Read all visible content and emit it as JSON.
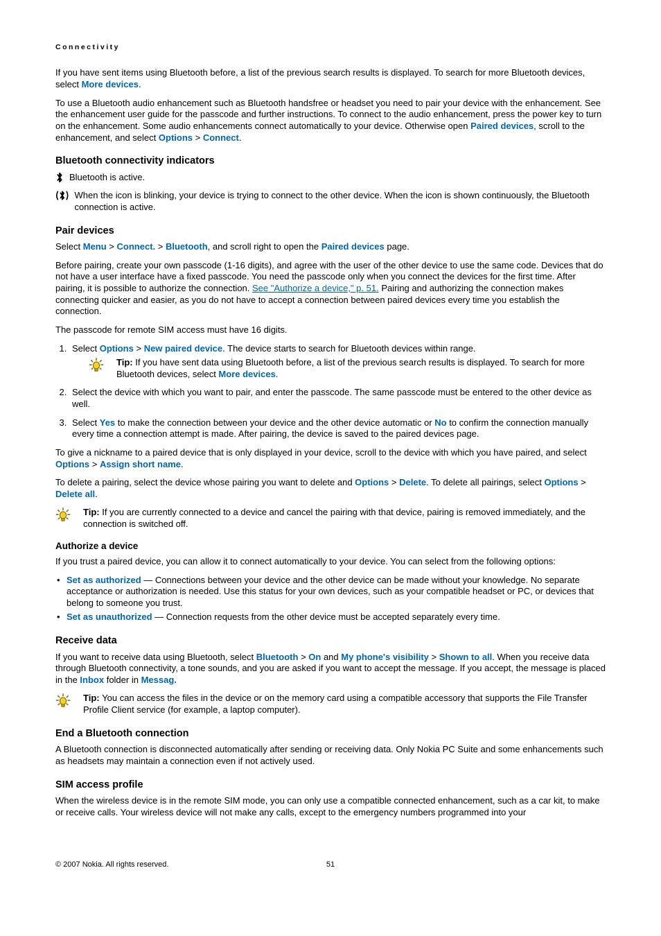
{
  "breadcrumb": "Connectivity",
  "intro": {
    "p1a": "If you have sent items using Bluetooth before, a list of the previous search results is displayed. To search for more Bluetooth devices, select ",
    "p1b": "More devices",
    "p1c": ".",
    "p2a": "To use a Bluetooth audio enhancement such as Bluetooth handsfree or headset you need to pair your device with the enhancement. See the enhancement user guide for the passcode and further instructions. To connect to the audio enhancement, press the power key to turn on the enhancement. Some audio enhancements connect automatically to your device. Otherwise open ",
    "p2b": "Paired devices",
    "p2c": ", scroll to the enhancement, and select ",
    "p2d": "Options",
    "gt": " > ",
    "p2e": "Connect",
    "p2f": "."
  },
  "bci": {
    "heading": "Bluetooth connectivity indicators",
    "l1": "  Bluetooth is active.",
    "l2": "  When the icon is blinking, your device is trying to connect to the other device. When the icon is shown continuously, the Bluetooth connection is active."
  },
  "pair": {
    "heading": "Pair devices",
    "sel_a": "Select ",
    "menu": "Menu",
    "connect": "Connect.",
    "bluetooth": "Bluetooth",
    "sel_b": ", and scroll right to open the ",
    "paired": "Paired devices",
    "sel_c": " page.",
    "p2a": "Before pairing, create your own passcode (1-16 digits), and agree with the user of the other device to use the same code. Devices that do not have a user interface have a fixed passcode. You need the passcode only when you connect the devices for the first time. After pairing, it is possible to authorize the connection. ",
    "p2link": "See \"Authorize a device,\" p. 51.",
    "p2b": " Pairing and authorizing the connection makes connecting quicker and easier, as you do not have to accept a connection between paired devices every time you establish the connection.",
    "p3": "The passcode for remote SIM access must have 16 digits.",
    "li1a": "Select ",
    "li1b": "Options",
    "li1c": "New paired device",
    "li1d": ". The device starts to search for Bluetooth devices within range.",
    "tip1_bold": "Tip: ",
    "tip1_a": "If you have sent data using Bluetooth before, a list of the previous search results is displayed. To search for more Bluetooth devices, select ",
    "tip1_b": "More devices",
    "tip1_c": ".",
    "li2": "Select the device with which you want to pair, and enter the passcode. The same passcode must be entered to the other device as well.",
    "li3a": "Select ",
    "li3yes": "Yes",
    "li3b": " to make the connection between your device and the other device automatic or ",
    "li3no": "No",
    "li3c": " to confirm the connection manually every time a connection attempt is made. After pairing, the device is saved to the paired devices page.",
    "nick_a": "To give a nickname to a paired device that is only displayed in your device, scroll to the device with which you have paired, and select ",
    "nick_opt": "Options",
    "nick_assign": "Assign short name",
    "nick_b": ".",
    "del_a": "To delete a pairing, select the device whose pairing you want to delete and ",
    "del_opt": "Options",
    "del_delete": "Delete",
    "del_b": ". To delete all pairings, select ",
    "del_opt2": "Options",
    "del_all": "Delete all",
    "del_c": ".",
    "tip2_bold": "Tip: ",
    "tip2": "If you are currently connected to a device and cancel the pairing with that device, pairing is removed immediately, and the connection is switched off."
  },
  "auth": {
    "heading": "Authorize a device",
    "p1": "If you trust a paired device, you can allow it to connect automatically to your device. You can select from the following options:",
    "b1_label": "Set as authorized",
    "b1_text": " — Connections between your device and the other device can be made without your knowledge. No separate acceptance or authorization is needed. Use this status for your own devices, such as your compatible headset or PC, or devices that belong to someone you trust.",
    "b2_label": "Set as unauthorized",
    "b2_text": " — Connection requests from the other device must be accepted separately every time."
  },
  "recv": {
    "heading": "Receive data",
    "p1a": "If you want to receive data using Bluetooth, select ",
    "bt": "Bluetooth",
    "on": "On",
    "p1b": " and ",
    "vis": "My phone's visibility",
    "shown": "Shown to all",
    "p1c": ". When you receive data through Bluetooth connectivity, a tone sounds, and you are asked if you want to accept the message. If you accept, the message is placed in the ",
    "inbox": "Inbox",
    "p1d": " folder in ",
    "messag": "Messag.",
    "tip_bold": "Tip: ",
    "tip": "You can access the files in the device or on the memory card using a compatible accessory that supports the File Transfer Profile Client service (for example, a laptop computer)."
  },
  "end": {
    "heading": "End a Bluetooth connection",
    "p": "A Bluetooth connection is disconnected automatically after sending or receiving data. Only Nokia PC Suite and some enhancements such as headsets may maintain a connection even if not actively used."
  },
  "sim": {
    "heading": "SIM access profile",
    "p": "When the wireless device is in the remote SIM mode, you can only use a compatible connected enhancement, such as a car kit, to make or receive calls. Your wireless device will not make any calls, except to the emergency numbers programmed into your"
  },
  "footer": {
    "copyright": "© 2007 Nokia. All rights reserved.",
    "page": "51"
  }
}
